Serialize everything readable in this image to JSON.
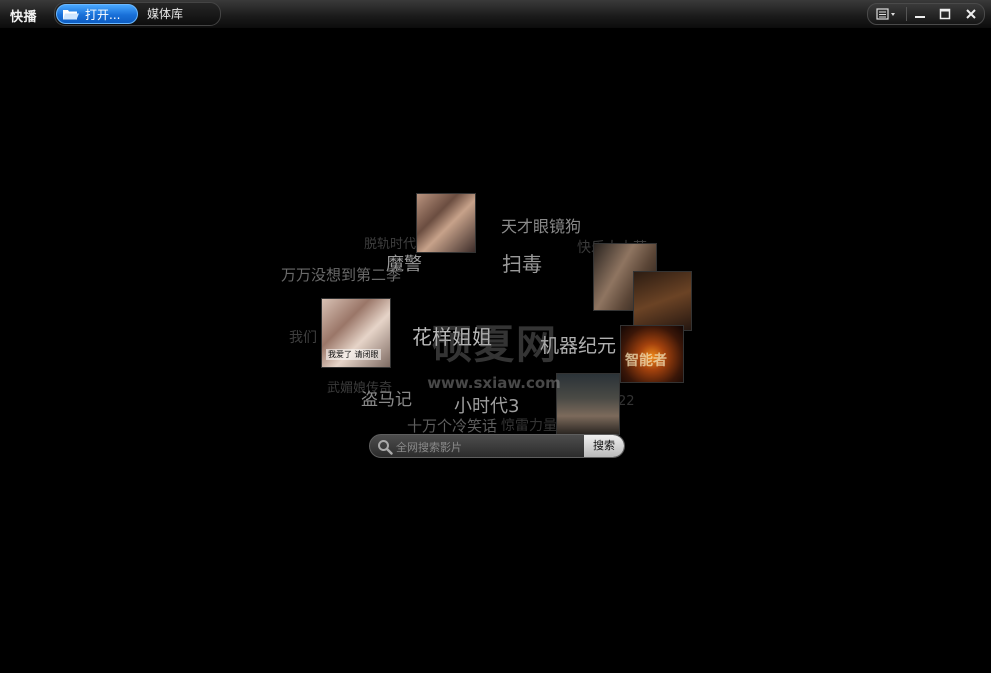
{
  "app": {
    "title": "快播"
  },
  "tabs": {
    "open_label": "打开...",
    "library_label": "媒体库"
  },
  "window_controls": {
    "menu_icon": "menu-dropdown-icon",
    "minimize_icon": "minimize-icon",
    "maximize_icon": "maximize-icon",
    "close_icon": "close-icon"
  },
  "cloud": {
    "watermark": "硕夏网",
    "watermark_url": "www.sxiaw.com",
    "words": [
      "天才眼镜狗",
      "脱轨时代",
      "魔警",
      "扫毒",
      "快乐大本营",
      "万万没想到第二季",
      "我们",
      "花样姐姐",
      "机器纪元",
      "武媚娘传奇",
      "盗马记",
      "小时代3",
      "十万个冷笑话",
      "惊雷力量",
      "22"
    ],
    "posters": [
      {
        "name": "poster-1",
        "caption": ""
      },
      {
        "name": "poster-2",
        "caption": ""
      },
      {
        "name": "poster-3",
        "caption": "我爱了 请闭眼"
      },
      {
        "name": "poster-4",
        "caption": "智能者"
      },
      {
        "name": "poster-5",
        "caption": ""
      }
    ]
  },
  "search": {
    "placeholder": "全网搜索影片",
    "button_label": "搜索"
  },
  "colors": {
    "accent": "#1970d8",
    "background": "#000000"
  }
}
